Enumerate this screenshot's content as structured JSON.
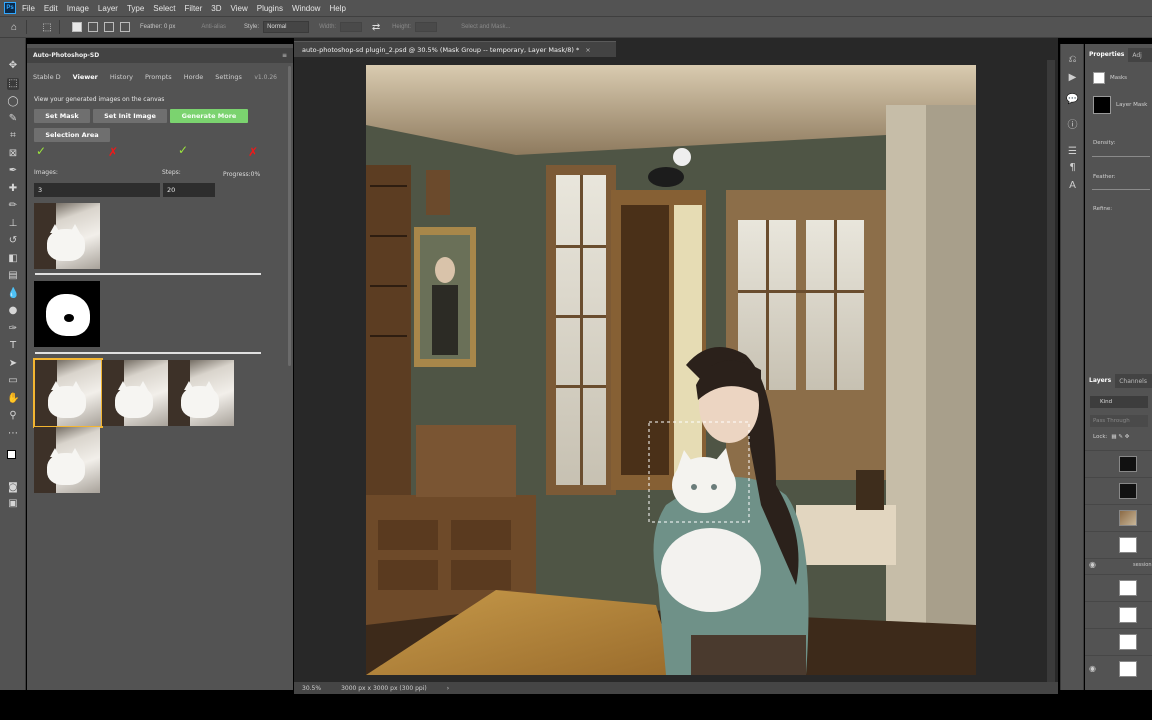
{
  "menubar": {
    "logo": "Ps",
    "items": [
      "File",
      "Edit",
      "Image",
      "Layer",
      "Type",
      "Select",
      "Filter",
      "3D",
      "View",
      "Plugins",
      "Window",
      "Help"
    ]
  },
  "options_bar": {
    "feather_label": "Feather: 0 px",
    "anti_alias_label": "Anti-alias",
    "style_label": "Style:",
    "style_value": "Normal",
    "width_label": "Width:",
    "height_label": "Height:",
    "select_mask_label": "Select and Mask..."
  },
  "plugin": {
    "title": "Auto-Photoshop-SD",
    "tabs": [
      "Stable D",
      "Viewer",
      "History",
      "Prompts",
      "Horde",
      "Settings"
    ],
    "active_tab": "Viewer",
    "version": "v1.0.26",
    "hint": "View your generated images on the canvas",
    "buttons": {
      "set_mask": "Set Mask",
      "set_init_image": "Set Init Image",
      "generate_more": "Generate More",
      "selection_area": "Selection Area"
    },
    "marks": [
      "✓",
      "✗",
      "✓",
      "✗"
    ],
    "images_label": "Images:",
    "images_value": "3",
    "steps_label": "Steps:",
    "steps_value": "20",
    "progress_label": "Progress:",
    "progress_value": "0%"
  },
  "document": {
    "tab_title": "auto-photoshop-sd plugin_2.psd @ 30.5% (Mask Group -- temporary, Layer Mask/8) *",
    "close": "×"
  },
  "status_bar": {
    "zoom": "30.5%",
    "dimensions": "3000 px x 3000 px (300 ppi)",
    "arrow": "›"
  },
  "properties": {
    "tabs": [
      "Properties",
      "Adj"
    ],
    "masks_label": "Masks",
    "layer_mask_label": "Layer Mask",
    "density_label": "Density:",
    "feather_label": "Feather:",
    "refine_label": "Refine:"
  },
  "layers": {
    "tabs": [
      "Layers",
      "Channels"
    ],
    "search": "Kind",
    "blend_mode": "Pass Through",
    "lock_label": "Lock:",
    "session_label": "session"
  },
  "colors": {
    "accent_green": "#7bd36f",
    "selected_thumb": "#f3b531",
    "error_red": "#f01818",
    "ok_green": "#9be53c"
  }
}
